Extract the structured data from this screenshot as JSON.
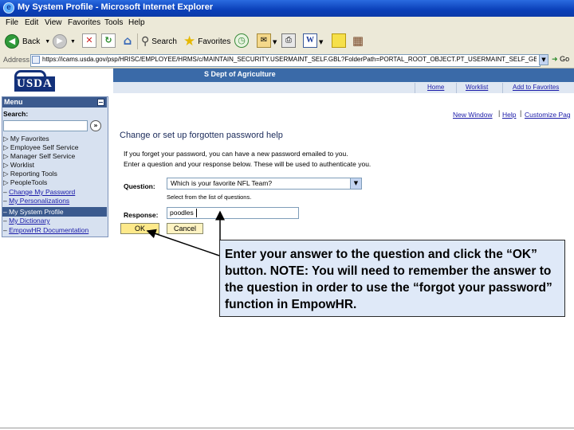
{
  "window": {
    "title": "My System Profile - Microsoft Internet Explorer"
  },
  "menubar": {
    "items": [
      "File",
      "Edit",
      "View",
      "Favorites",
      "Tools",
      "Help"
    ]
  },
  "toolbar": {
    "back_label": "Back",
    "search_label": "Search",
    "favorites_label": "Favorites"
  },
  "address": {
    "label": "Address",
    "url": "https://icams.usda.gov/psp/HRISC/EMPLOYEE/HRMS/c/MAINTAIN_SECURITY.USERMAINT_SELF.GBL?FolderPath=PORTAL_ROOT_OBJECT.PT_USERMAINT_SELF_GBL&IsF",
    "go_label": "Go"
  },
  "header": {
    "logo_text": "USDA",
    "banner_text": "S Dept of Agriculture",
    "nav_links": [
      "Home",
      "Worklist",
      "Add to Favorites"
    ],
    "sub_links": [
      "New Window",
      "Help",
      "Customize Pag"
    ]
  },
  "sidebar": {
    "title": "Menu",
    "search_label": "Search:",
    "items": [
      {
        "label": "My Favorites",
        "link": false
      },
      {
        "label": "Employee Self Service",
        "link": false
      },
      {
        "label": "Manager Self Service",
        "link": false
      },
      {
        "label": "Worklist",
        "link": false
      },
      {
        "label": "Reporting Tools",
        "link": false
      },
      {
        "label": "PeopleTools",
        "link": false
      },
      {
        "label": "Change My Password",
        "link": true
      },
      {
        "label": "My Personalizations",
        "link": true
      },
      {
        "label": "My System Profile",
        "link": true
      },
      {
        "label": "My Dictionary",
        "link": true
      },
      {
        "label": "EmpowHR Documentation",
        "link": true
      }
    ]
  },
  "content": {
    "heading": "Change or set up forgotten password help",
    "intro_line1": "If you forget your password, you can have a new password emailed to you.",
    "intro_line2": "Enter a question and your response below. These will be used to authenticate you.",
    "question_label": "Question:",
    "question_value": "Which is your favorite NFL Team?",
    "question_hint": "Select from the list of questions.",
    "response_label": "Response:",
    "response_value": "poodles",
    "ok_label": "OK",
    "cancel_label": "Cancel"
  },
  "callout": {
    "text": "Enter your answer to the question and click the “OK” button.  NOTE:  You will need to remember the answer to the question in order to use the “forgot your password” function in EmpowHR."
  },
  "colors": {
    "accent": "#3b5a8e",
    "callout_bg": "#dfe9f8",
    "banner": "#3a6aa8"
  }
}
